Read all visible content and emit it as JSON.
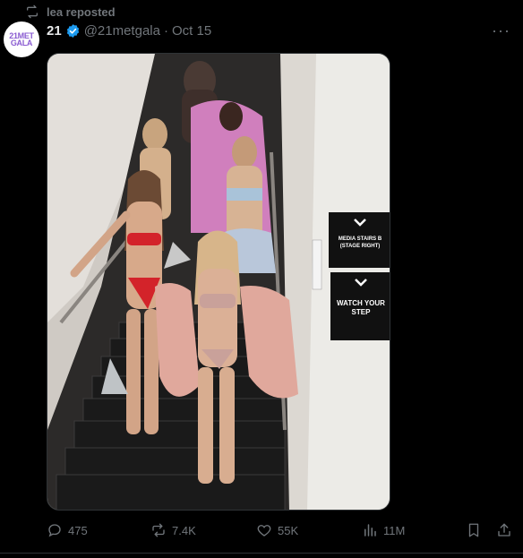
{
  "repost": {
    "text": "lea reposted",
    "icon": "repost-icon"
  },
  "author": {
    "avatar_logo_line1": "21MET",
    "avatar_logo_line2": "GALA",
    "display_name": "21",
    "verified": true,
    "handle": "@21metgala",
    "separator": "·",
    "date": "Oct 15"
  },
  "more_menu": {
    "icon": "more-icon",
    "label": "···"
  },
  "media": {
    "type": "photo",
    "signs": [
      {
        "lines": [
          "MEDIA STAIRS B",
          "(STAGE RIGHT)"
        ]
      },
      {
        "lines": [
          "WATCH YOUR",
          "STEP"
        ]
      }
    ]
  },
  "actions": {
    "reply": {
      "icon": "reply-icon",
      "count": "475"
    },
    "repost": {
      "icon": "repost-icon",
      "count": "7.4K"
    },
    "like": {
      "icon": "heart-icon",
      "count": "55K"
    },
    "views": {
      "icon": "views-icon",
      "count": "11M"
    },
    "bookmark": {
      "icon": "bookmark-icon"
    },
    "share": {
      "icon": "share-icon"
    }
  },
  "colors": {
    "background": "#000000",
    "text": "#e7e9ea",
    "muted": "#71767b",
    "verified": "#1d9bf0",
    "border": "#2f3336"
  }
}
